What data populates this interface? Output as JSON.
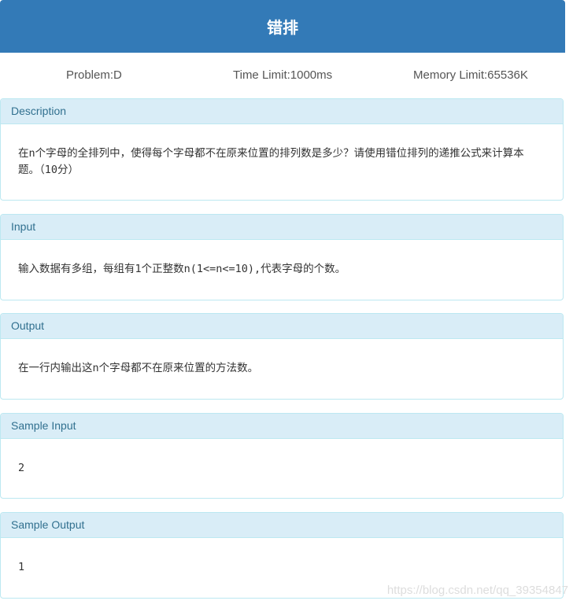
{
  "title": "错排",
  "meta": {
    "problem": "Problem:D",
    "time_limit": "Time Limit:1000ms",
    "memory_limit": "Memory Limit:65536K"
  },
  "sections": {
    "description": {
      "heading": "Description",
      "body": "在n个字母的全排列中，使得每个字母都不在原来位置的排列数是多少？请使用错位排列的递推公式来计算本题。（10分）"
    },
    "input": {
      "heading": "Input",
      "body": "输入数据有多组，每组有1个正整数n(1<=n<=10),代表字母的个数。"
    },
    "output": {
      "heading": "Output",
      "body": "在一行内输出这n个字母都不在原来位置的方法数。"
    },
    "sample_input": {
      "heading": "Sample Input",
      "body": "2"
    },
    "sample_output": {
      "heading": "Sample Output",
      "body": "1"
    }
  },
  "watermark": "https://blog.csdn.net/qq_39354847"
}
